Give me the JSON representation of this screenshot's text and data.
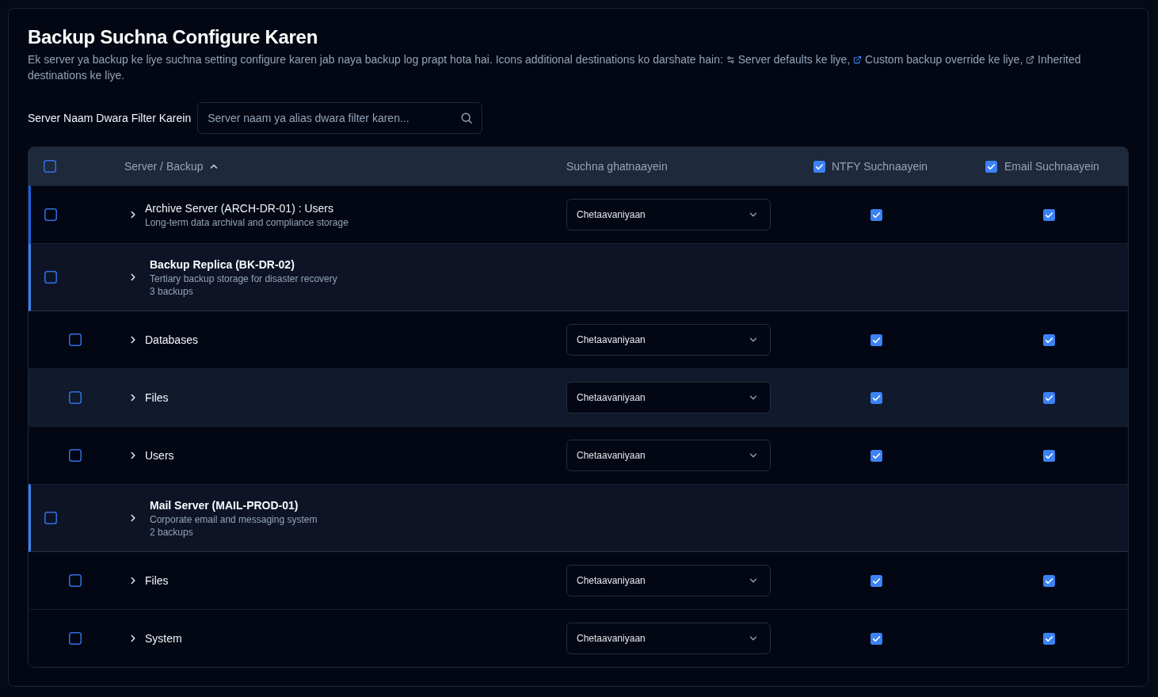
{
  "header": {
    "title": "Backup Suchna Configure Karen",
    "description": {
      "intro": "Ek server ya backup ke liye suchna setting configure karen jab naya backup log prapt hota hai. Icons additional destinations ko darshate hain:",
      "legend": [
        {
          "kind": "server_default",
          "text": "Server defaults ke liye,"
        },
        {
          "kind": "custom_override",
          "text": "Custom backup override ke liye,"
        },
        {
          "kind": "inherited",
          "text": "Inherited destinations ke liye."
        }
      ]
    }
  },
  "filter": {
    "label": "Server Naam Dwara Filter Karein",
    "placeholder": "Server naam ya alias dwara filter karen..."
  },
  "table": {
    "select_all": {
      "checked": false
    },
    "columns": [
      {
        "kind": "name",
        "label": "Server / Backup",
        "sorted": true
      },
      {
        "kind": "events",
        "label": "Suchna ghatnaayein"
      },
      {
        "kind": "ntfy",
        "label": "NTFY Suchnaayein",
        "checked": true
      },
      {
        "kind": "email",
        "label": "Email Suchnaayein",
        "checked": true
      }
    ],
    "rows": [
      {
        "kind": "backup",
        "name": "Archive Server (ARCH-DR-01) : Users",
        "description": "Long-term data archival and compliance storage",
        "checked": false,
        "highlighted": false,
        "events": "Chetaavaniyaan",
        "ntfy": true,
        "email": true
      },
      {
        "kind": "server",
        "name": "Backup Replica (BK-DR-02)",
        "description": "Tertiary backup storage for disaster recovery",
        "backup_count": "3 backups",
        "checked": false,
        "highlighted": false,
        "children": [
          {
            "kind": "backup",
            "name": "Databases",
            "checked": false,
            "highlighted": false,
            "events": "Chetaavaniyaan",
            "ntfy": true,
            "email": true
          },
          {
            "kind": "backup",
            "name": "Files",
            "checked": false,
            "highlighted": true,
            "events": "Chetaavaniyaan",
            "ntfy": true,
            "email": true
          },
          {
            "kind": "backup",
            "name": "Users",
            "checked": false,
            "highlighted": false,
            "events": "Chetaavaniyaan",
            "ntfy": true,
            "email": true
          }
        ]
      },
      {
        "kind": "server",
        "name": "Mail Server (MAIL-PROD-01)",
        "description": "Corporate email and messaging system",
        "backup_count": "2 backups",
        "checked": false,
        "highlighted": false,
        "children": [
          {
            "kind": "backup",
            "name": "Files",
            "checked": false,
            "highlighted": false,
            "events": "Chetaavaniyaan",
            "ntfy": true,
            "email": true
          },
          {
            "kind": "backup",
            "name": "System",
            "checked": false,
            "highlighted": false,
            "events": "Chetaavaniyaan",
            "ntfy": true,
            "email": true
          }
        ]
      }
    ]
  }
}
